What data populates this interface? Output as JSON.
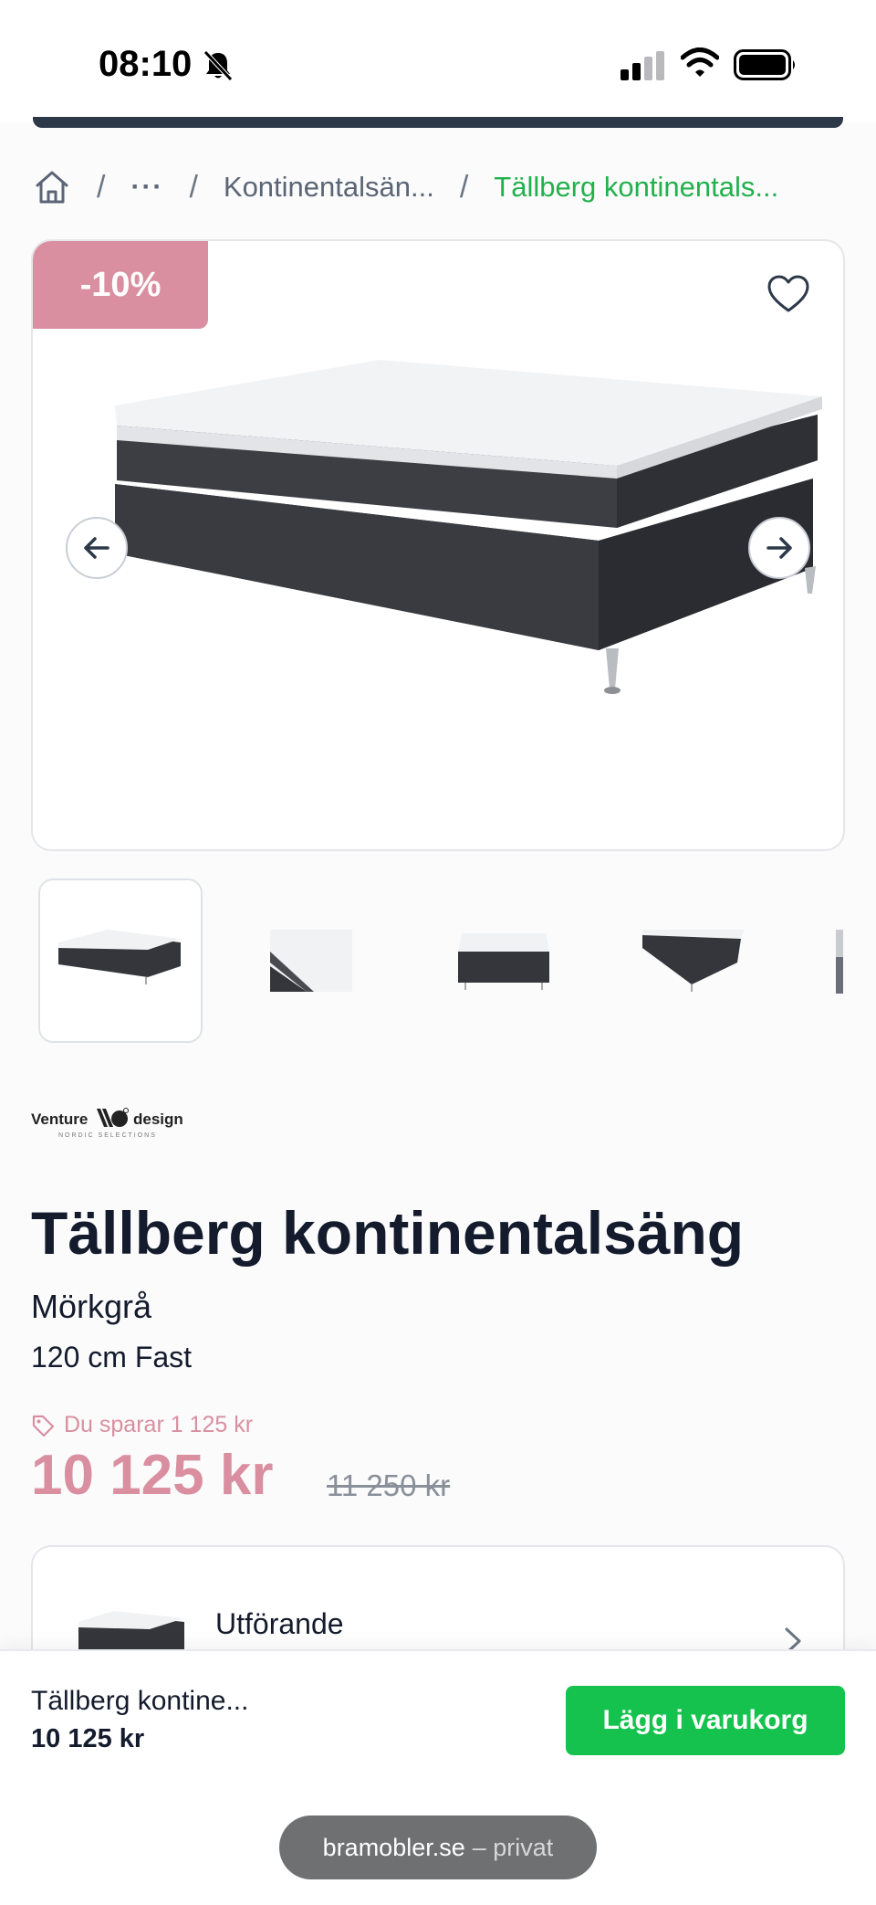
{
  "status_bar": {
    "time": "08:10",
    "icons": [
      "bell-slash-icon",
      "cellular-signal-icon",
      "wifi-icon",
      "battery-icon"
    ]
  },
  "breadcrumb": {
    "home_icon": "home-icon",
    "more": "···",
    "separator": "/",
    "category": "Kontinentalsän...",
    "current": "Tällberg kontinentals..."
  },
  "gallery": {
    "discount_badge": "-10%",
    "favorite_icon": "heart-outline-icon",
    "prev_icon": "arrow-left-icon",
    "next_icon": "arrow-right-icon",
    "thumbnail_count": 5
  },
  "brand": {
    "name_left": "Venture",
    "name_right": "design",
    "tagline": "NORDIC SELECTIONS"
  },
  "product": {
    "title": "Tällberg kontinentalsäng",
    "color": "Mörkgrå",
    "variant": "120 cm Fast",
    "savings": "Du sparar 1 125 kr",
    "price": "10 125 kr",
    "original_price": "11 250 kr"
  },
  "option": {
    "label": "Utförande"
  },
  "bottom_bar": {
    "name": "Tällberg kontine...",
    "price": "10 125 kr",
    "cart_label": "Lägg i varukorg"
  },
  "browser": {
    "domain": "bramobler.se",
    "mode": "– privat"
  },
  "colors": {
    "accent_green": "#15c24d",
    "sale_pink": "#d98fa0",
    "text_dark": "#141b2d"
  }
}
